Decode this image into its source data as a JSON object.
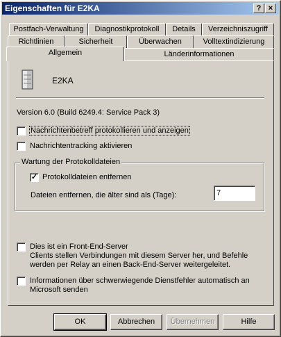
{
  "window": {
    "title": "Eigenschaften für E2KA",
    "help_btn": "?",
    "close_btn": "×"
  },
  "tabs": {
    "row1": [
      "Postfach-Verwaltung",
      "Diagnostikprotokoll",
      "Details",
      "Verzeichniszugriff"
    ],
    "row2": [
      "Richtlinien",
      "Sicherheit",
      "Überwachen",
      "Volltextindizierung"
    ],
    "row3": [
      "Allgemein",
      "Länderinformationen"
    ],
    "active": "Allgemein"
  },
  "general": {
    "server_name": "E2KA",
    "version": "Version 6.0 (Build 6249.4: Service Pack 3)",
    "log_subject": {
      "label": "Nachrichtenbetreff protokollieren und anzeigen",
      "checked": false
    },
    "tracking": {
      "label": "Nachrichtentracking aktivieren",
      "checked": false
    },
    "maintenance": {
      "title": "Wartung der Protokolldateien",
      "remove_logs": {
        "label": "Protokolldateien entfernen",
        "checked": true
      },
      "days_label": "Dateien entfernen, die älter sind als (Tage):",
      "days_value": "7"
    },
    "frontend": {
      "label": "Dies ist ein Front-End-Server",
      "checked": false,
      "description": "Clients stellen Verbindungen mit diesem Server her, und Befehle werden per Relay an einen Back-End-Server weitergeleitet."
    },
    "report_errors": {
      "label_line1": "Informationen über schwerwiegende Dienstfehler automatisch an",
      "label_line2": "Microsoft senden",
      "checked": false
    }
  },
  "buttons": {
    "ok": "OK",
    "cancel": "Abbrechen",
    "apply": "Übernehmen",
    "help": "Hilfe"
  }
}
